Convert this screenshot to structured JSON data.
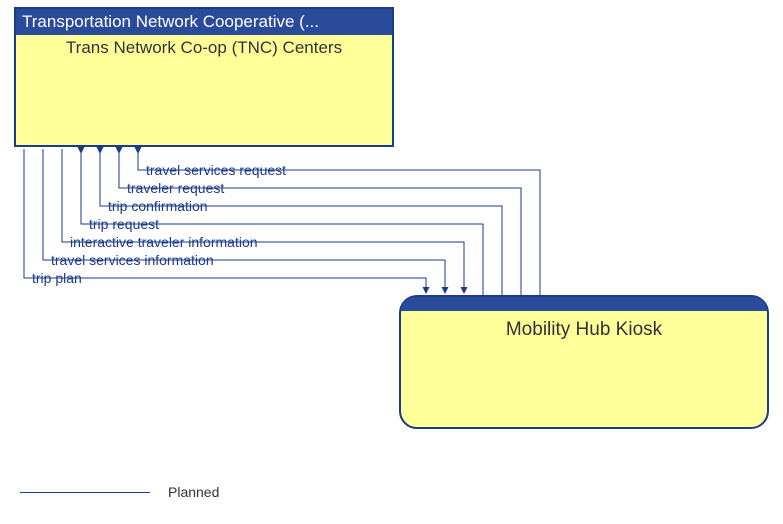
{
  "boxes": {
    "tnc": {
      "header": "Transportation Network Cooperative (...",
      "subtitle": "Trans Network Co-op (TNC) Centers"
    },
    "kiosk": {
      "label": "Mobility Hub Kiosk"
    }
  },
  "flows": {
    "to_tnc": [
      "travel services request",
      "traveler request",
      "trip confirmation",
      "trip request"
    ],
    "to_kiosk": [
      "interactive traveler information",
      "travel services information",
      "trip plan"
    ]
  },
  "legend": {
    "planned": "Planned"
  }
}
